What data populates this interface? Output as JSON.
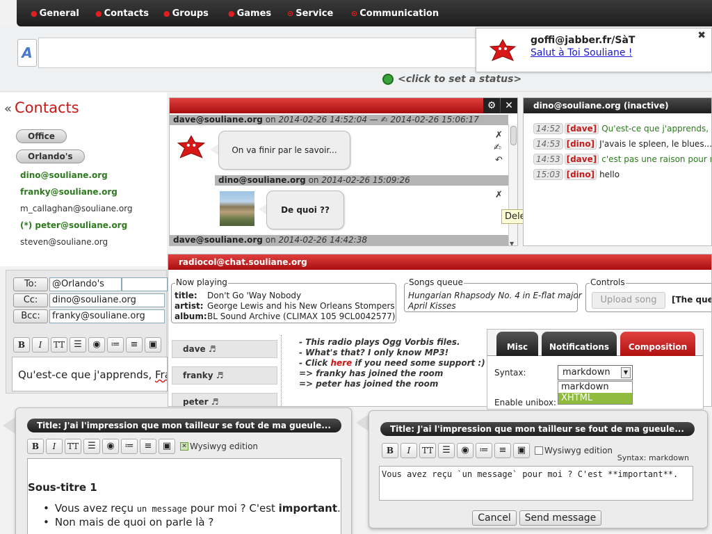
{
  "menu": [
    "General",
    "Contacts",
    "Groups",
    "Games",
    "Service",
    "Communication"
  ],
  "notification": {
    "jid": "goffi@jabber.fr/SàT",
    "message": "Salut à Toi Souliane !",
    "close": "✖"
  },
  "status": {
    "text": "<click to set a status>"
  },
  "contacts": {
    "title": "Contacts",
    "chevron": "«",
    "groups": [
      "Office",
      "Orlando's"
    ],
    "items": [
      {
        "jid": "dino@souliane.org"
      },
      {
        "jid": "franky@souliane.org"
      },
      {
        "jid": "m_callaghan@souliane.org"
      },
      {
        "jid": "(*) peter@souliane.org"
      },
      {
        "jid": "steven@souliane.org"
      }
    ]
  },
  "composer": {
    "to_label": "To:",
    "to_value": "@Orlando's",
    "cc_label": "Cc:",
    "cc_value": "dino@souliane.org",
    "bcc_label": "Bcc:",
    "bcc_value": "franky@souliane.org",
    "text_start": "Qu'est-ce que j'apprends, ",
    "text_end": "Franl"
  },
  "toolbar_labels": {
    "bold": "B",
    "italic": "I",
    "tt": "TT"
  },
  "chat": {
    "messages": [
      {
        "from": "dave@souliane.org",
        "on": "on",
        "date": "2014-02-26 14:52:04 — ✍ 2014-02-26 15:06:17",
        "text": "On va finir par le savoir..."
      },
      {
        "from": "dino@souliane.org",
        "on": "on",
        "date": "2014-02-26 15:09:26",
        "text": "De quoi ??"
      },
      {
        "from": "dave@souliane.org",
        "on": "on",
        "date": "2014-02-26 14:42:38"
      }
    ],
    "tooltip": "Delete this message"
  },
  "chat2": {
    "title": "dino@souliane.org (inactive)",
    "lines": [
      {
        "time": "14:52",
        "nick": "[dave]",
        "text": "Qu'est-ce que j'apprends, Fran"
      },
      {
        "time": "14:53",
        "nick": "[dino]",
        "text": "J'avais le spleen, le blues..."
      },
      {
        "time": "14:53",
        "nick": "[dave]",
        "text": "c'est pas une raison pour ne p"
      },
      {
        "time": "15:03",
        "nick": "[dino]",
        "text": "hello"
      }
    ]
  },
  "radio": {
    "title": "radiocol@chat.souliane.org",
    "now_playing": {
      "legend": "Now playing",
      "title_label": "title:",
      "title": "Don't Go 'Way Nobody",
      "artist_label": "artist:",
      "artist": "George Lewis and his New Orleans Stompers",
      "album_label": "album:",
      "album": "BL Sound Archive (CLIMAX 105 9CL0042577)"
    },
    "queue": {
      "legend": "Songs queue",
      "songs": [
        "Hungarian Rhapsody No. 4 in E-flat major",
        "April Kisses"
      ]
    },
    "controls": {
      "legend": "Controls",
      "upload": "Upload song",
      "queue_label": "[The queu"
    },
    "users": [
      "dave ♬",
      "franky ♬",
      "peter ♬"
    ],
    "log": {
      "line1": "- This radio plays Ogg Vorbis files.",
      "line2": "- What's that? I only know MP3!",
      "line3_a": "- Click ",
      "line3_link": "here",
      "line3_b": " if you need some support :)",
      "line4": "=> franky has joined the room",
      "line5": "=> peter has joined the room"
    }
  },
  "settings": {
    "tabs": [
      "Misc",
      "Notifications",
      "Composition"
    ],
    "syntax_label": "Syntax:",
    "selected": "markdown",
    "options": [
      "markdown",
      "XHTML"
    ],
    "unibox_label": "Enable unibox:"
  },
  "popup_left": {
    "title": "Title: J'ai l'impression que mon tailleur se fout de ma gueule...",
    "wysiwyg": "Wysiwyg edition",
    "heading": "Sous-titre 1",
    "li1_a": "Vous avez reçu ",
    "li1_code": "un message",
    "li1_b": " pour moi ? C'est ",
    "li1_bold": "important",
    "li1_c": ".",
    "li2": "Non mais de quoi on parle là ?"
  },
  "popup_right": {
    "title": "Title: J'ai l'impression que mon tailleur se fout de ma gueule...",
    "wysiwyg": "Wysiwyg edition",
    "syntax_status": "Syntax: markdown",
    "text": "Vous avez reçu `un message` pour moi ? C'est **important**.",
    "cancel": "Cancel",
    "send": "Send message"
  },
  "colors": {
    "accent_red": "#c81818",
    "online_green": "#2e7a1e",
    "selection_green": "#8fbb3e"
  }
}
